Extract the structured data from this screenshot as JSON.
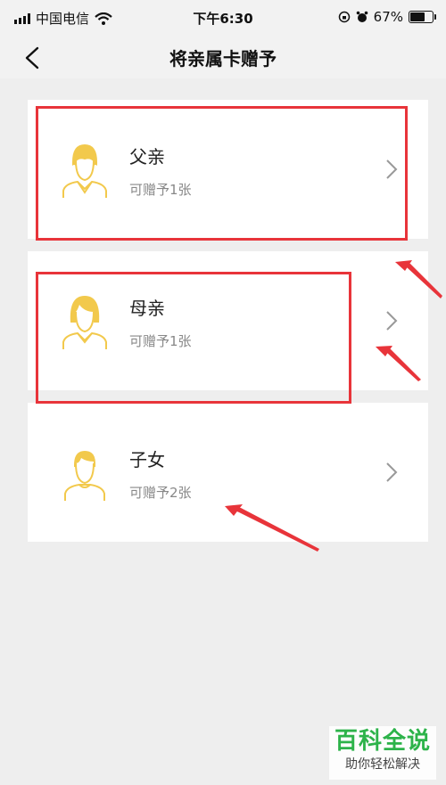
{
  "status": {
    "carrier": "中国电信",
    "time": "下午6:30",
    "battery": "67%"
  },
  "nav": {
    "title": "将亲属卡赠予"
  },
  "cards": [
    {
      "name": "父亲",
      "sub": "可赠予1张"
    },
    {
      "name": "母亲",
      "sub": "可赠予1张"
    },
    {
      "name": "子女",
      "sub": "可赠予2张"
    }
  ],
  "colors": {
    "accent": "#f2c94c",
    "highlight": "#e8343a",
    "watermark": "#2db34a"
  },
  "icons": [
    "signal-icon",
    "wifi-icon",
    "lock-rotation-icon",
    "alarm-icon",
    "battery-icon",
    "back-icon",
    "avatar-icon",
    "chevron-right-icon"
  ],
  "watermark": {
    "title": "百科全说",
    "sub": "助你轻松解决"
  }
}
